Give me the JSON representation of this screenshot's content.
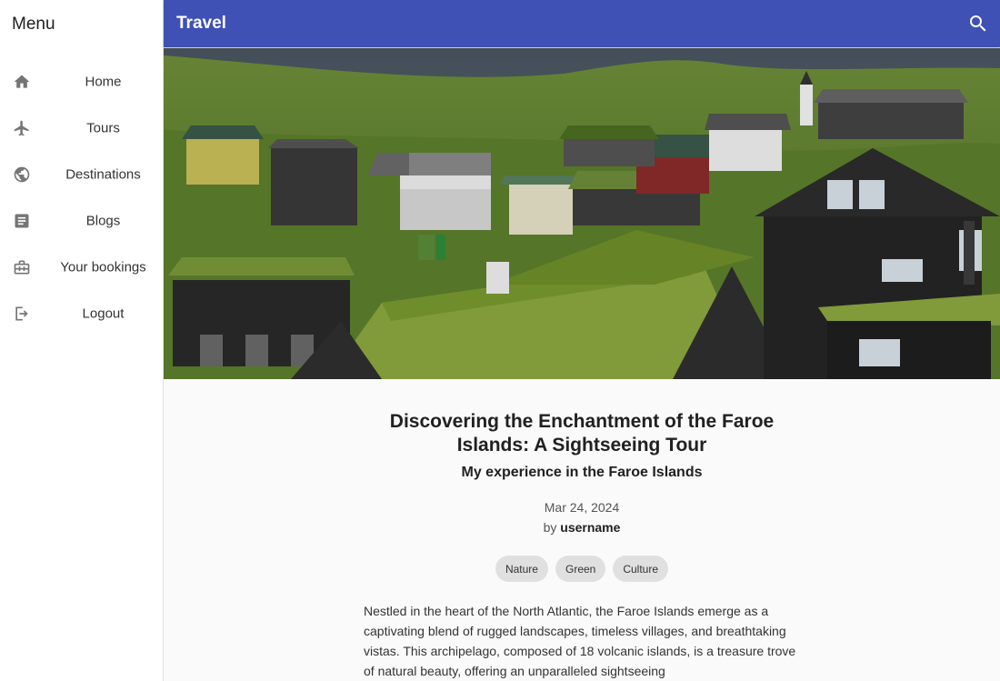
{
  "sidebar": {
    "title": "Menu",
    "items": [
      {
        "label": "Home",
        "icon": "home-icon"
      },
      {
        "label": "Tours",
        "icon": "airplane-icon"
      },
      {
        "label": "Destinations",
        "icon": "globe-icon"
      },
      {
        "label": "Blogs",
        "icon": "article-icon"
      },
      {
        "label": "Your bookings",
        "icon": "briefcase-icon"
      },
      {
        "label": "Logout",
        "icon": "logout-icon"
      }
    ]
  },
  "header": {
    "title": "Travel",
    "search_icon": "search-icon"
  },
  "article": {
    "title": "Discovering the Enchantment of the Faroe Islands: A Sightseeing Tour",
    "subtitle": "My experience in the Faroe Islands",
    "date": "Mar 24, 2024",
    "by_prefix": "by",
    "author": "username",
    "tags": [
      "Nature",
      "Green",
      "Culture"
    ],
    "body": "Nestled in the heart of the North Atlantic, the Faroe Islands emerge as a captivating blend of rugged landscapes, timeless villages, and breathtaking vistas. This archipelago, composed of 18 volcanic islands, is a treasure trove of natural beauty, offering an unparalleled sightseeing"
  },
  "colors": {
    "appbar": "#3f51b5",
    "sidebar_bg": "#ffffff",
    "page_bg": "#fafafa",
    "tag_bg": "#e0e0e0",
    "icon_gray": "#757575"
  }
}
